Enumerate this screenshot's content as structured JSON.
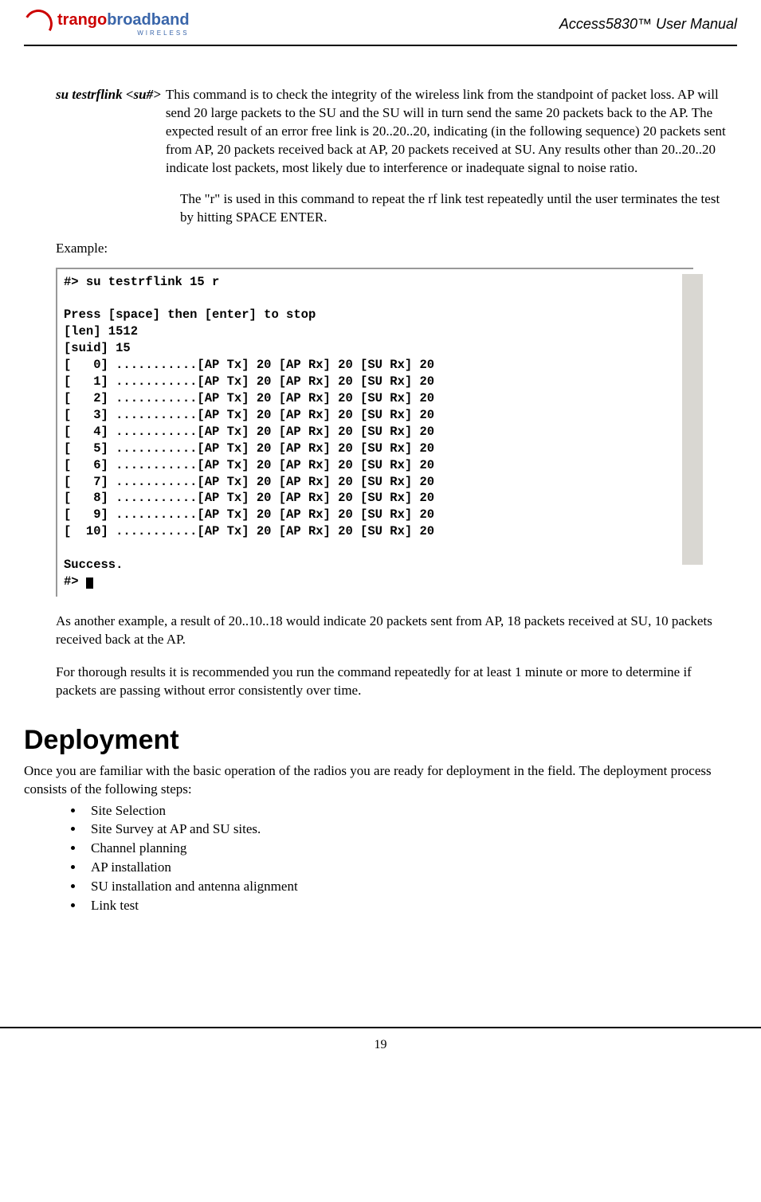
{
  "header": {
    "logo_text1": "trango",
    "logo_text2": "broadband",
    "logo_sub": "WIRELESS",
    "manual_title": "Access5830™ User Manual"
  },
  "command": {
    "name": "su testrflink <su#>",
    "desc": "This command is to check the integrity of the wireless link from the standpoint of packet loss.  AP will send 20 large packets to the SU and the SU will in turn send the same 20 packets back to the AP.  The expected result of an error free link is 20..20..20, indicating (in the following sequence) 20 packets sent from AP, 20 packets received back at AP, 20 packets received at SU.  Any results other than 20..20..20 indicate lost packets, most likely due to interference or inadequate signal to noise ratio.",
    "r_note": "The \"r\" is used in this command to repeat the rf link test repeatedly until the user terminates the test by hitting SPACE ENTER."
  },
  "example_label": "Example:",
  "console_lines": "#> su testrflink 15 r\n\nPress [space] then [enter] to stop\n[len] 1512\n[suid] 15\n[   0] ...........[AP Tx] 20 [AP Rx] 20 [SU Rx] 20\n[   1] ...........[AP Tx] 20 [AP Rx] 20 [SU Rx] 20\n[   2] ...........[AP Tx] 20 [AP Rx] 20 [SU Rx] 20\n[   3] ...........[AP Tx] 20 [AP Rx] 20 [SU Rx] 20\n[   4] ...........[AP Tx] 20 [AP Rx] 20 [SU Rx] 20\n[   5] ...........[AP Tx] 20 [AP Rx] 20 [SU Rx] 20\n[   6] ...........[AP Tx] 20 [AP Rx] 20 [SU Rx] 20\n[   7] ...........[AP Tx] 20 [AP Rx] 20 [SU Rx] 20\n[   8] ...........[AP Tx] 20 [AP Rx] 20 [SU Rx] 20\n[   9] ...........[AP Tx] 20 [AP Rx] 20 [SU Rx] 20\n[  10] ...........[AP Tx] 20 [AP Rx] 20 [SU Rx] 20\n\nSuccess.\n#> ",
  "after_console_1": "As another example, a result of 20..10..18 would indicate 20 packets sent from AP, 18 packets received at SU, 10 packets received back at the AP.",
  "after_console_2": "For thorough results it is recommended you run the command repeatedly for at least 1 minute or more to determine if packets are passing without error consistently over time.",
  "deployment": {
    "heading": "Deployment",
    "intro": "Once you are familiar with the basic operation of the radios you are ready for deployment in the field.  The deployment process consists of the following steps:",
    "items": [
      "Site Selection",
      "Site Survey at AP and SU sites.",
      "Channel planning",
      "AP installation",
      "SU installation and antenna alignment",
      "Link test"
    ]
  },
  "page_number": "19"
}
